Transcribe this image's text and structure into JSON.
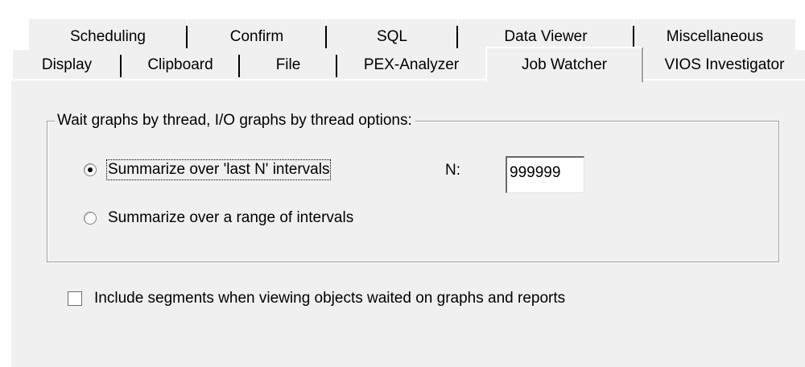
{
  "tabs": {
    "row1": [
      {
        "label": "Scheduling"
      },
      {
        "label": "Confirm"
      },
      {
        "label": "SQL"
      },
      {
        "label": "Data Viewer"
      },
      {
        "label": "Miscellaneous"
      }
    ],
    "row2": [
      {
        "label": "Display"
      },
      {
        "label": "Clipboard"
      },
      {
        "label": "File"
      },
      {
        "label": "PEX-Analyzer"
      },
      {
        "label": "Job Watcher",
        "selected": true
      },
      {
        "label": "VIOS Investigator"
      }
    ]
  },
  "group": {
    "title": "Wait graphs by thread, I/O graphs by thread options:",
    "radio_last_n": {
      "label": "Summarize over 'last N' intervals",
      "checked": true
    },
    "radio_range": {
      "label": "Summarize over a range of intervals",
      "checked": false
    },
    "n_label": "N:",
    "n_value": "999999"
  },
  "include_segments": {
    "label": "Include segments when viewing objects waited on graphs and reports",
    "checked": false
  },
  "colors": {
    "dialog_bg": "#f0f0f0",
    "border_shadow": "#a0a0a0",
    "highlight": "#ffffff"
  }
}
